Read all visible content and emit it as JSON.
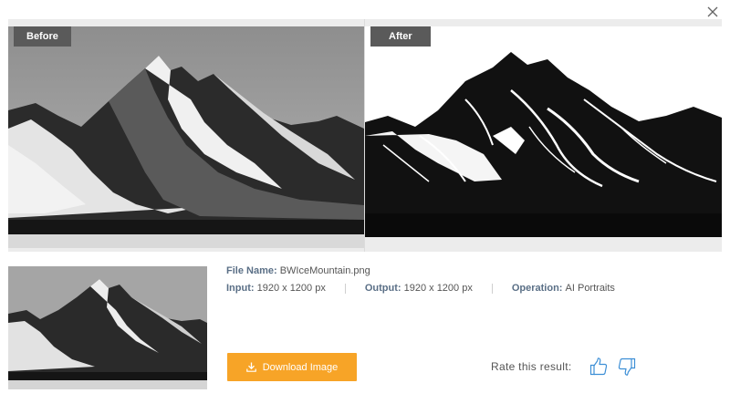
{
  "dialog": {
    "close_icon": "close-icon"
  },
  "compare": {
    "before_label": "Before",
    "after_label": "After"
  },
  "info": {
    "file_name_key": "File Name:",
    "file_name_value": "BWIceMountain.png",
    "input_key": "Input:",
    "input_value": "1920 x 1200 px",
    "output_key": "Output:",
    "output_value": "1920 x 1200 px",
    "operation_key": "Operation:",
    "operation_value": "AI Portraits"
  },
  "actions": {
    "download_label": "Download Image",
    "download_icon": "download-icon",
    "download_color": "#f7a427",
    "rate_label": "Rate this result:",
    "thumbs_up_icon": "thumbs-up-icon",
    "thumbs_down_icon": "thumbs-down-icon",
    "icon_color": "#3d8fd6"
  }
}
